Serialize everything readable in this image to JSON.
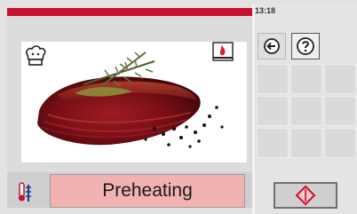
{
  "status": {
    "time": "13:18",
    "progress_bar_color": "#c8102e"
  },
  "program": {
    "image": "roast-beef-with-rosemary",
    "mode_icon": "chef-hat-icon",
    "heat_icon": "top-heat-icon"
  },
  "footer": {
    "probe_icon": "core-temp-probe-icon",
    "status_label": "Preheating",
    "status_bg_color": "#f2b2b2"
  },
  "sidebar": {
    "buttons": [
      {
        "name": "back-button",
        "icon": "back-arrow-icon"
      },
      {
        "name": "help-button",
        "icon": "question-mark-icon"
      }
    ],
    "start_stop_icon": "start-stop-diamond-icon"
  }
}
